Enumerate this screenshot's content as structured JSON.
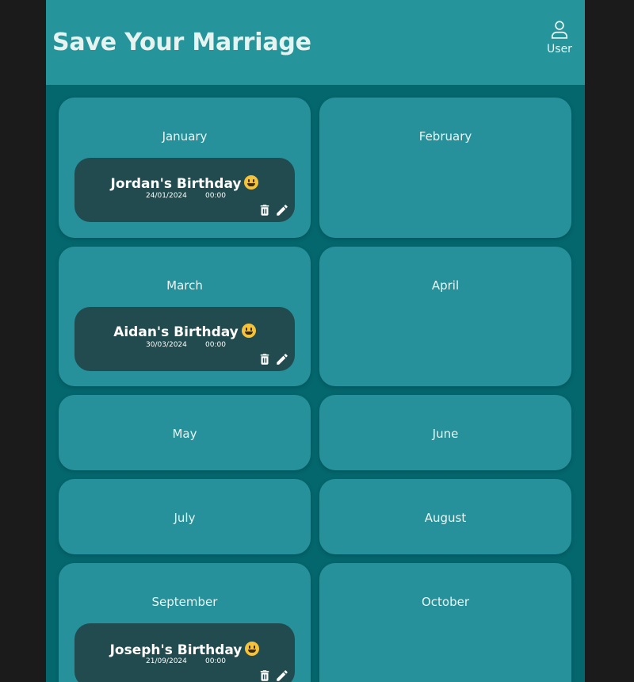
{
  "header": {
    "title": "Save Your Marriage",
    "user_label": "User"
  },
  "months": [
    {
      "name": "January",
      "events": [
        {
          "title": "Jordan's Birthday",
          "emoji": "grinning-face",
          "date": "24/01/2024",
          "time": "00:00"
        }
      ]
    },
    {
      "name": "February",
      "events": []
    },
    {
      "name": "March",
      "events": [
        {
          "title": "Aidan's Birthday",
          "emoji": "grinning-face",
          "date": "30/03/2024",
          "time": "00:00"
        }
      ]
    },
    {
      "name": "April",
      "events": []
    },
    {
      "name": "May",
      "events": []
    },
    {
      "name": "June",
      "events": []
    },
    {
      "name": "July",
      "events": []
    },
    {
      "name": "August",
      "events": []
    },
    {
      "name": "September",
      "events": [
        {
          "title": "Joseph's Birthday",
          "emoji": "grinning-face",
          "date": "21/09/2024",
          "time": "00:00"
        }
      ]
    },
    {
      "name": "October",
      "events": []
    }
  ],
  "icons": {
    "user": "user-icon",
    "delete": "trash-icon",
    "edit": "pencil-icon"
  },
  "colors": {
    "background": "#04676e",
    "header": "#26959b",
    "month_card": "#26919a",
    "event_card": "#214b4e",
    "outer": "#1b1b1b"
  }
}
